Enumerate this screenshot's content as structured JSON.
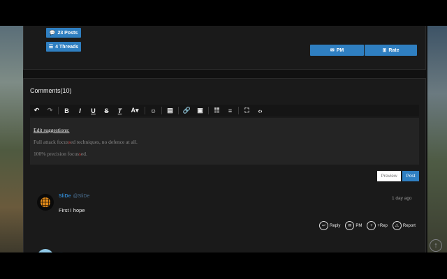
{
  "profile": {
    "posts_label": "23 Posts",
    "threads_label": "4 Threads",
    "pm_label": "PM",
    "rate_label": "Rate"
  },
  "comments": {
    "title": "Comments(10)",
    "editor": {
      "heading": "Edit suggestions:",
      "line1_a": "Full attack focus",
      "line1_red": "s",
      "line1_b": "ed techniques, no defence at all.",
      "line2_a": "100% precision focus",
      "line2_red": "s",
      "line2_b": "ed."
    },
    "preview_label": "Preview",
    "post_label": "Post",
    "items": [
      {
        "user": "SliDe",
        "handle": "@SliDe",
        "time": "1 day ago",
        "text": "First I hope",
        "actions": [
          "Reply",
          "PM",
          "+Rep",
          "Report"
        ]
      },
      {
        "user": "...",
        "handle": "..."
      }
    ]
  },
  "colors": {
    "accent": "#2f7fc1",
    "panel": "#1a1a1a",
    "page": "#111111",
    "highlight": "#d43030"
  }
}
